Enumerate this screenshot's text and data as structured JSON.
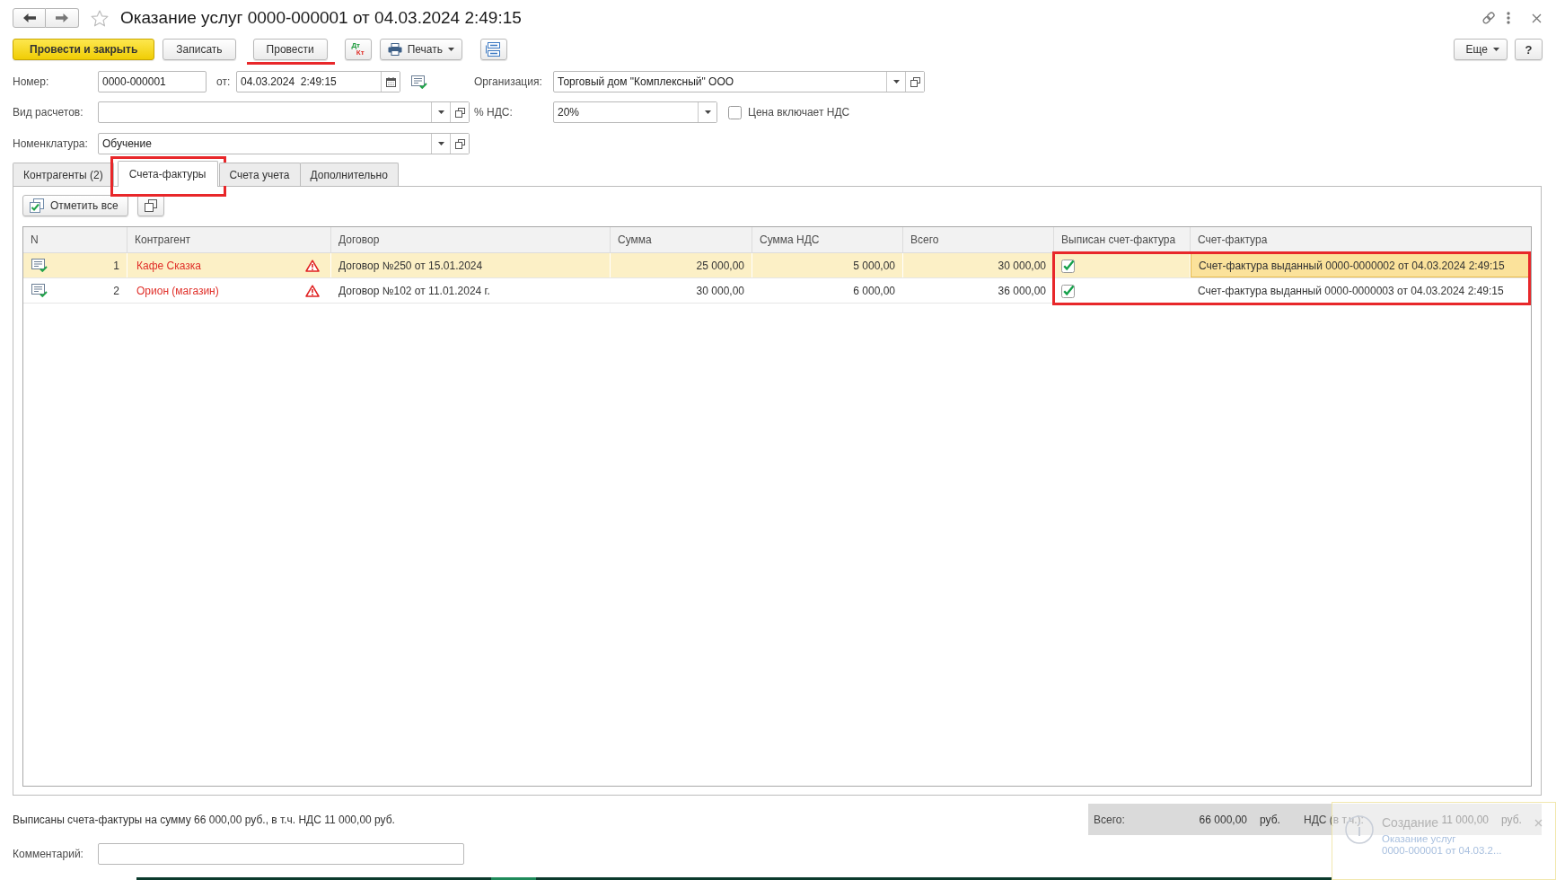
{
  "window": {
    "title": "Оказание услуг 0000-000001 от 04.03.2024 2:49:15",
    "favorite": false
  },
  "toolbar": {
    "buttons": [
      {
        "kind": "primary",
        "label": "Провести и закрыть",
        "marked": false
      },
      {
        "kind": "plain",
        "label": "Записать",
        "marked": false
      },
      {
        "kind": "plain",
        "label": "Провести",
        "marked": true
      },
      {
        "kind": "ledger",
        "debit": "Дт",
        "credit": "Кт",
        "marked": false
      },
      {
        "kind": "print",
        "label": "Печать",
        "marked": false
      },
      {
        "kind": "structure",
        "marked": false
      }
    ],
    "right_buttons": [
      {
        "kind": "menu",
        "label": "Еще"
      },
      {
        "kind": "help",
        "label": "?"
      }
    ]
  },
  "form": {
    "number": {
      "label": "Номер:",
      "value": "0000-000001"
    },
    "date": {
      "label": "от:",
      "value": "04.03.2024  2:49:15"
    },
    "organization": {
      "label": "Организация:",
      "value": "Торговый дом \"Комплексный\" ООО"
    },
    "payment_type": {
      "label": "Вид расчетов:"
    },
    "vat_rate": {
      "label": "% НДС:",
      "value": "20%"
    },
    "price_includes_vat": {
      "label": "Цена включает НДС",
      "checked": false
    },
    "nomenclature": {
      "label": "Номенклатура:",
      "value": "Обучение"
    }
  },
  "tabs": [
    {
      "label": "Контрагенты (2)",
      "selected": false,
      "marked": false
    },
    {
      "label": "Счета-фактуры",
      "selected": true,
      "marked": true
    },
    {
      "label": "Счета учета",
      "selected": false,
      "marked": false
    },
    {
      "label": "Дополнительно",
      "selected": false,
      "marked": false
    }
  ],
  "panel": {
    "buttons": [
      {
        "kind": "markall",
        "label": "Отметить все"
      },
      {
        "kind": "copy"
      }
    ],
    "table": {
      "columns": [
        {
          "label": "N",
          "marked": false
        },
        {
          "label": "Контрагент",
          "marked": false
        },
        {
          "label": "Договор",
          "marked": false
        },
        {
          "label": "Сумма",
          "marked": false
        },
        {
          "label": "Сумма НДС",
          "marked": false
        },
        {
          "label": "Всего",
          "marked": false
        },
        {
          "label": "Выписан счет-фактура",
          "marked": true
        },
        {
          "label": "Счет-фактура",
          "marked": true
        }
      ],
      "rows": [
        {
          "selected": true,
          "n": "1",
          "counterparty": "Кафе Сказка",
          "warning": true,
          "contract": "Договор №250 от 15.01.2024",
          "amount": "25 000,00",
          "vat": "5 000,00",
          "total": "30 000,00",
          "invoice_issued": true,
          "invoice": "Счет-фактура выданный 0000-0000002 от 04.03.2024 2:49:15"
        },
        {
          "selected": false,
          "n": "2",
          "counterparty": "Орион (магазин)",
          "warning": true,
          "contract": "Договор №102 от 11.01.2024 г.",
          "amount": "30 000,00",
          "vat": "6 000,00",
          "total": "36 000,00",
          "invoice_issued": true,
          "invoice": "Счет-фактура выданный 0000-0000003 от 04.03.2024 2:49:15"
        }
      ]
    }
  },
  "footer": {
    "summary": "Выписаны счета-фактуры на сумму 66 000,00 руб., в т.ч. НДС 11 000,00 руб.",
    "totals": [
      {
        "label": "Всего:",
        "value": "66 000,00",
        "unit": "руб."
      },
      {
        "label": "НДС (в т.ч.):",
        "value": "11 000,00",
        "unit": "руб."
      }
    ],
    "comment": {
      "label": "Комментарий:"
    }
  },
  "notification": {
    "title": "Создание",
    "link": "Оказание услуг\n0000-000001 от 04.03.2..."
  }
}
